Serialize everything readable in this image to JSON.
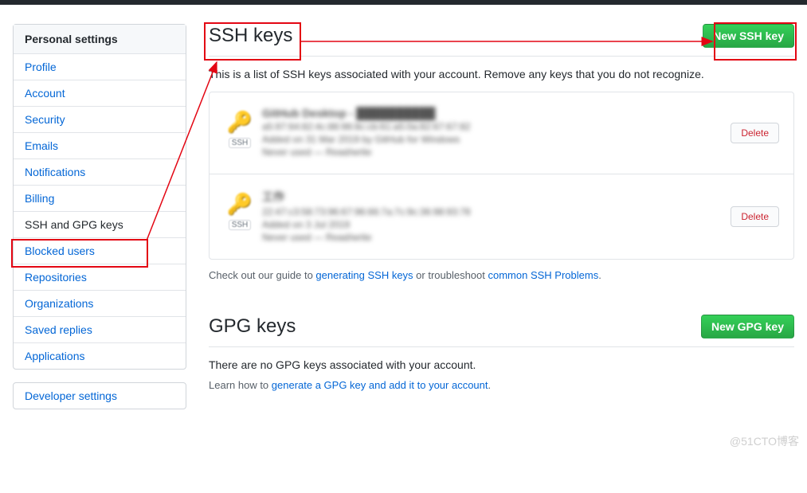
{
  "sidebar": {
    "header": "Personal settings",
    "items": [
      "Profile",
      "Account",
      "Security",
      "Emails",
      "Notifications",
      "Billing",
      "SSH and GPG keys",
      "Blocked users",
      "Repositories",
      "Organizations",
      "Saved replies",
      "Applications"
    ],
    "developer": "Developer settings"
  },
  "ssh": {
    "title": "SSH keys",
    "new_btn": "New SSH key",
    "description": "This is a list of SSH keys associated with your account. Remove any keys that you do not recognize.",
    "keys": [
      {
        "badge": "SSH",
        "title": "GitHub Desktop - ██████████",
        "fingerprint": "a5:97:64:82:4c:88:98:8c:cb:61:a5:0a:82:67:67:82",
        "added": "Added on 31 Mar 2019 by GitHub for Windows",
        "usage": "Never used — Read/write",
        "delete": "Delete"
      },
      {
        "badge": "SSH",
        "title": "工作",
        "fingerprint": "22:47:c3:58:73:96:67:96:66:7a:7c:9c:36:98:93:78",
        "added": "Added on 3 Jul 2019",
        "usage": "Never used — Read/write",
        "delete": "Delete"
      }
    ],
    "help_prefix": "Check out our guide to ",
    "help_link1": "generating SSH keys",
    "help_mid": " or troubleshoot ",
    "help_link2": "common SSH Problems",
    "help_suffix": "."
  },
  "gpg": {
    "title": "GPG keys",
    "new_btn": "New GPG key",
    "empty": "There are no GPG keys associated with your account.",
    "learn_prefix": "Learn how to ",
    "learn_link": "generate a GPG key and add it to your account",
    "learn_suffix": "."
  },
  "watermark": "@51CTO博客"
}
